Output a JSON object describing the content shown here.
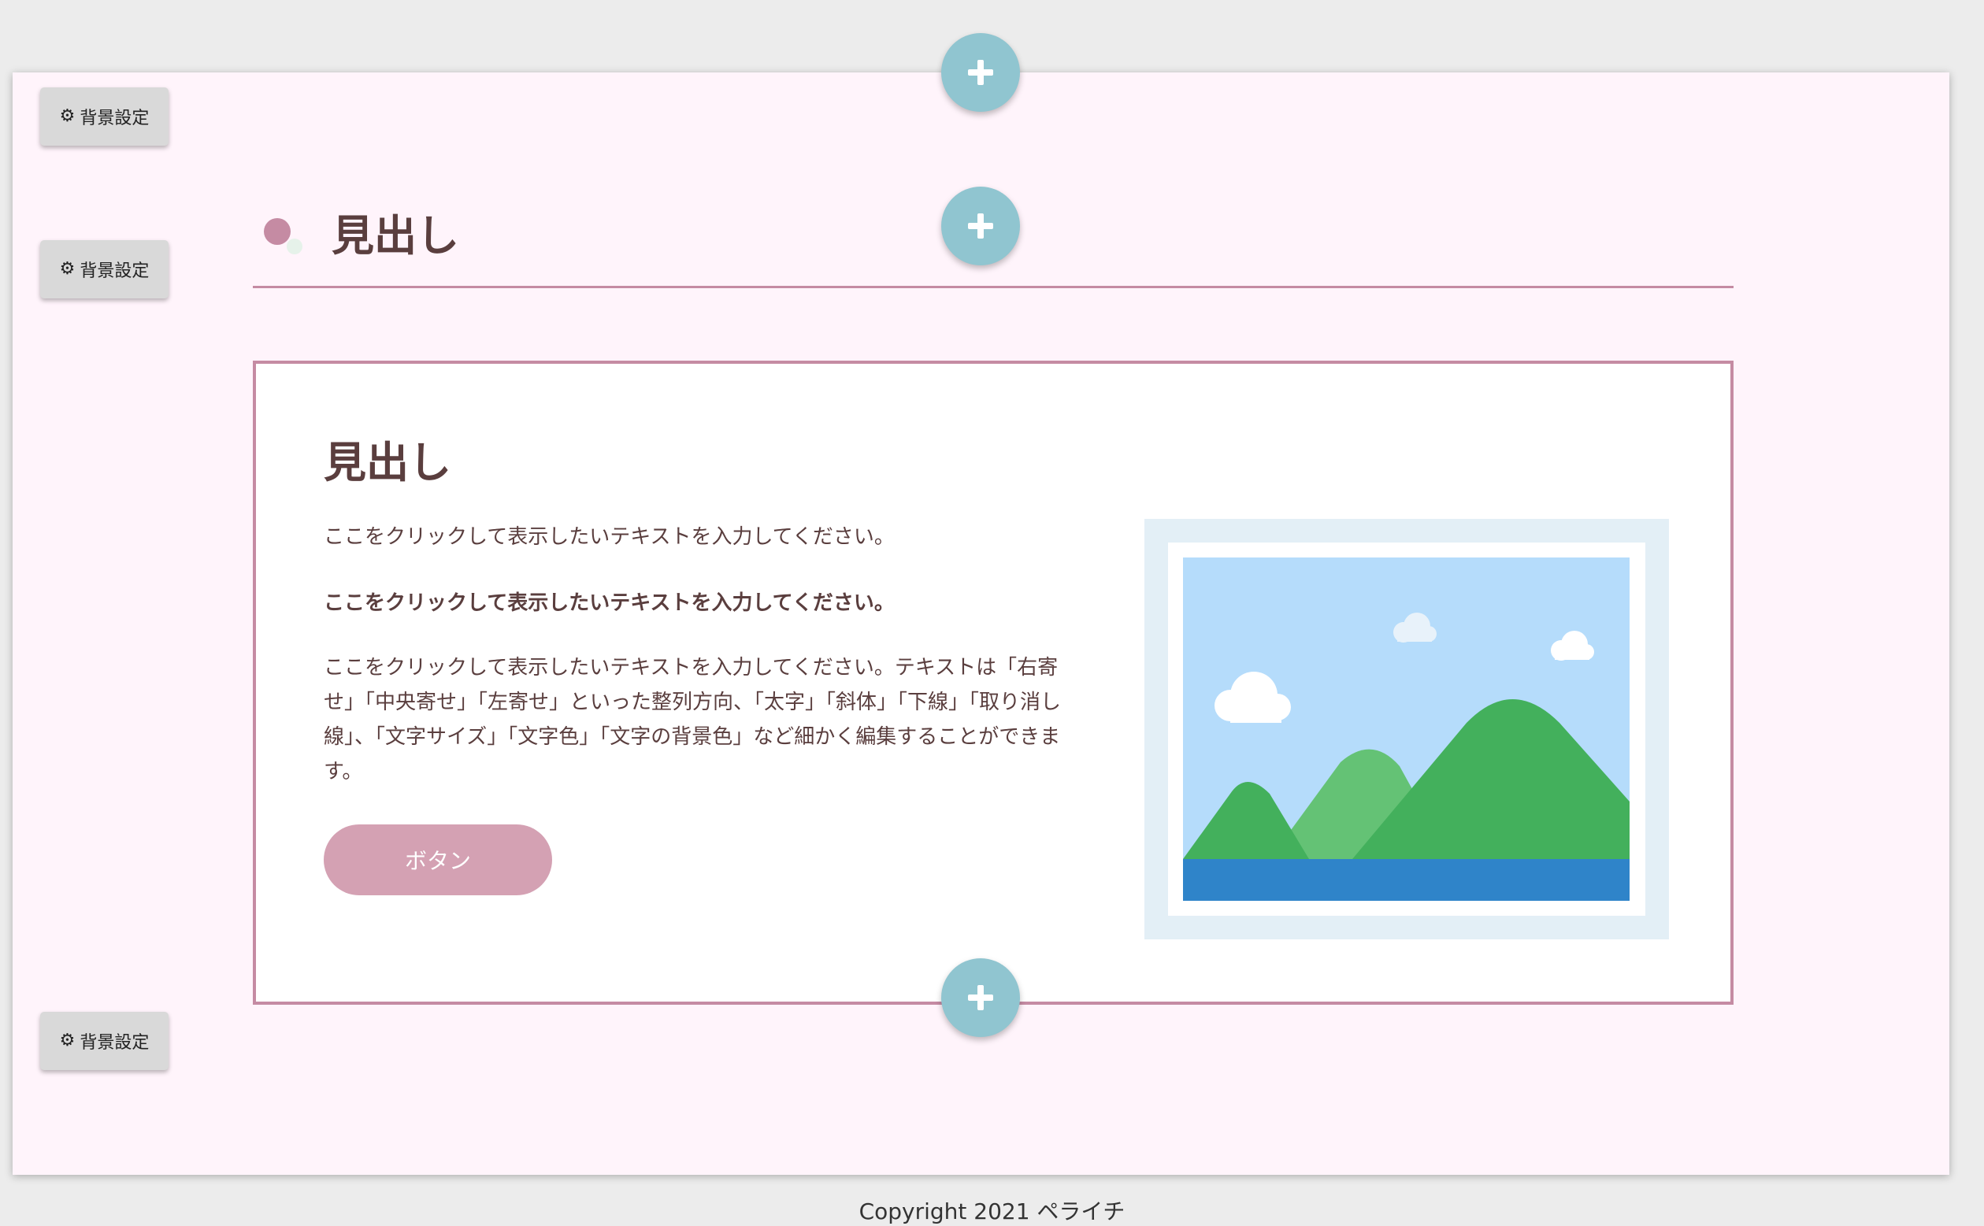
{
  "toolbar": {
    "bg_setting_label": "背景設定",
    "add_section_icon": "plus-icon",
    "gear_icon": "gear-icon"
  },
  "heading_section": {
    "title": "見出し",
    "accent_color": "#c58ba3"
  },
  "content_card": {
    "title": "見出し",
    "text_line_1": "ここをクリックして表示したいテキストを入力してください。",
    "text_line_2_bold": "ここをクリックして表示したいテキストを入力してください。",
    "paragraph": "ここをクリックして表示したいテキストを入力してください。テキストは「右寄せ」「中央寄せ」「左寄せ」といった整列方向、「太字」「斜体」「下線」「取り消し線」、「文字サイズ」「文字色」「文字の背景色」など細かく編集することができます。",
    "button_label": "ボタン",
    "image_icon": "landscape-image-placeholder",
    "border_color": "#c58ba3",
    "button_color": "#d4a1b3"
  },
  "footer": {
    "copyright": "Copyright 2021 ペライチ"
  },
  "colors": {
    "page_bg": "#fff4fb",
    "add_button": "#90c5d0",
    "heading_text": "#5a3e3e"
  }
}
